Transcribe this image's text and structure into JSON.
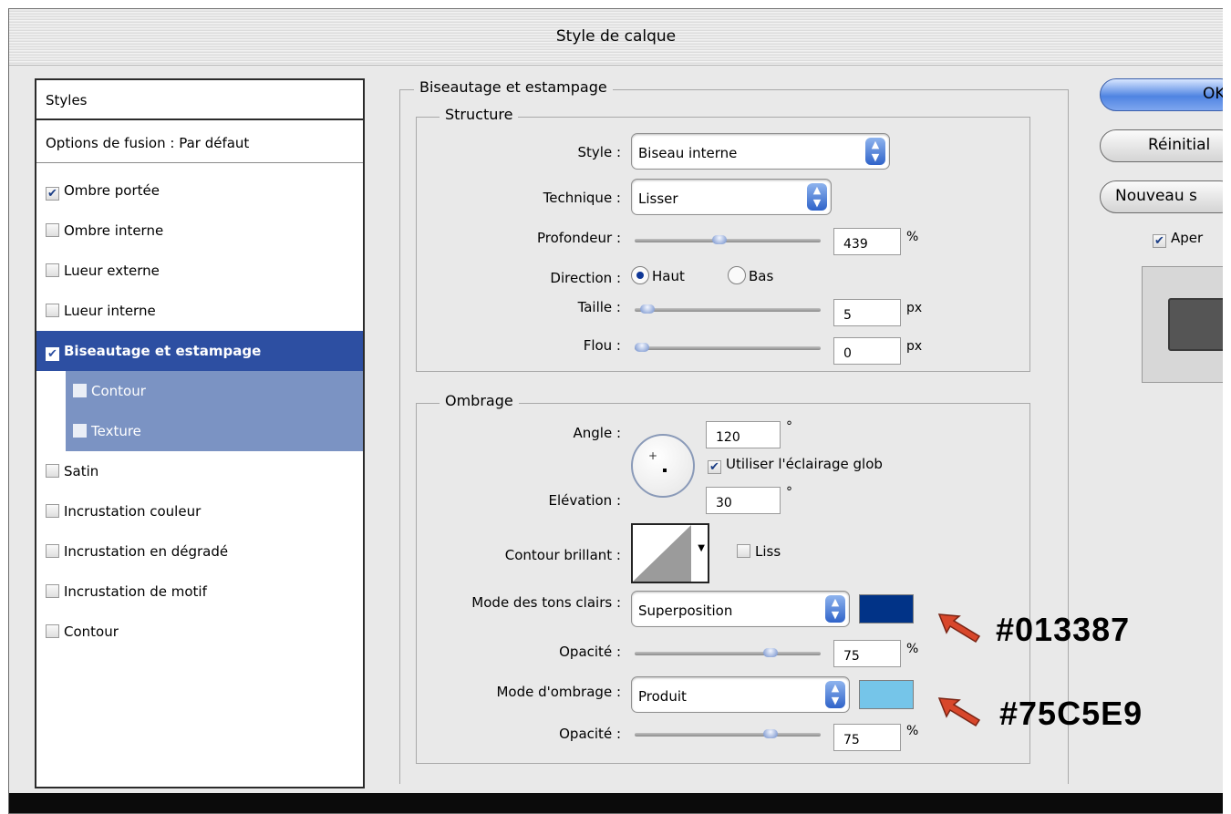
{
  "window": {
    "title": "Style de calque"
  },
  "styles_panel": {
    "header": "Styles",
    "blend_options": "Options de fusion : Par défaut",
    "items": [
      {
        "label": "Ombre portée",
        "checked": true
      },
      {
        "label": "Ombre interne",
        "checked": false
      },
      {
        "label": "Lueur externe",
        "checked": false
      },
      {
        "label": "Lueur interne",
        "checked": false
      },
      {
        "label": "Biseautage et estampage",
        "checked": true,
        "selected": true
      },
      {
        "label": "Contour",
        "checked": false,
        "sub": true
      },
      {
        "label": "Texture",
        "checked": false,
        "sub": true
      },
      {
        "label": "Satin",
        "checked": false
      },
      {
        "label": "Incrustation couleur",
        "checked": false
      },
      {
        "label": "Incrustation en dégradé",
        "checked": false
      },
      {
        "label": "Incrustation de motif",
        "checked": false
      },
      {
        "label": "Contour",
        "checked": false
      }
    ]
  },
  "bevel": {
    "title": "Biseautage et estampage",
    "structure": {
      "title": "Structure",
      "style": {
        "label": "Style :",
        "value": "Biseau interne"
      },
      "technique": {
        "label": "Technique :",
        "value": "Lisser"
      },
      "depth": {
        "label": "Profondeur :",
        "value": "439",
        "unit": "%",
        "slider": 0.45
      },
      "direction": {
        "label": "Direction :",
        "up": "Haut",
        "down": "Bas",
        "selected": "Haut"
      },
      "size": {
        "label": "Taille :",
        "value": "5",
        "unit": "px",
        "slider": 0.03
      },
      "soften": {
        "label": "Flou :",
        "value": "0",
        "unit": "px",
        "slider": 0.0
      }
    },
    "shading": {
      "title": "Ombrage",
      "angle": {
        "label": "Angle :",
        "value": "120",
        "unit": "°"
      },
      "global_light": {
        "label": "Utiliser l'éclairage glob",
        "checked": true
      },
      "altitude": {
        "label": "Elévation :",
        "value": "30",
        "unit": "°"
      },
      "gloss_contour": {
        "label": "Contour brillant :"
      },
      "antialias": {
        "label": "Liss",
        "checked": false
      },
      "highlight_mode": {
        "label": "Mode des tons clairs :",
        "value": "Superposition",
        "color": "#013387"
      },
      "highlight_opacity": {
        "label": "Opacité :",
        "value": "75",
        "unit": "%",
        "slider": 0.75
      },
      "shadow_mode": {
        "label": "Mode d'ombrage :",
        "value": "Produit",
        "color": "#75C5E9"
      },
      "shadow_opacity": {
        "label": "Opacité :",
        "value": "75",
        "unit": "%",
        "slider": 0.75
      }
    }
  },
  "buttons": {
    "ok": "OK",
    "reset": "Réinitial",
    "new_style": "Nouveau s",
    "preview": {
      "label": "Aper",
      "checked": true
    }
  },
  "annotations": {
    "highlight_hex": "#013387",
    "shadow_hex": "#75C5E9",
    "arrow_color": "#d8472b"
  }
}
